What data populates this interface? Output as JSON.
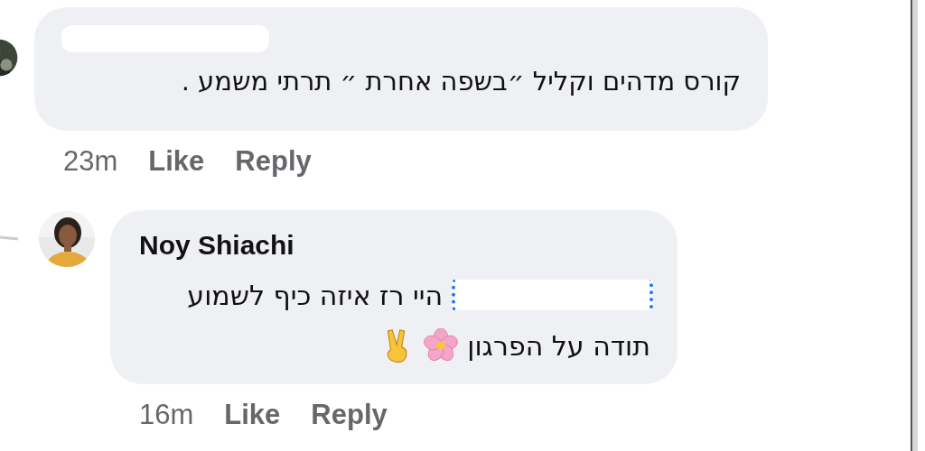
{
  "comments": [
    {
      "kind": "top",
      "name_redacted": true,
      "lines": [
        [
          {
            "kind": "text",
            "text": "קורס מדהים וקליל ״בשפה אחרת ״ תרתי משמע ."
          }
        ]
      ],
      "time": "23m",
      "actions": [
        "Like",
        "Reply"
      ]
    },
    {
      "kind": "reply",
      "author": "Noy Shiachi",
      "lines": [
        [
          {
            "kind": "redacted"
          },
          {
            "kind": "text",
            "text": "היי רז איזה כיף לשמוע"
          }
        ],
        [
          {
            "kind": "text",
            "text": "תודה על הפרגון"
          },
          {
            "kind": "flower"
          },
          {
            "kind": "victory"
          }
        ]
      ],
      "time": "16m",
      "actions": [
        "Like",
        "Reply"
      ]
    }
  ]
}
